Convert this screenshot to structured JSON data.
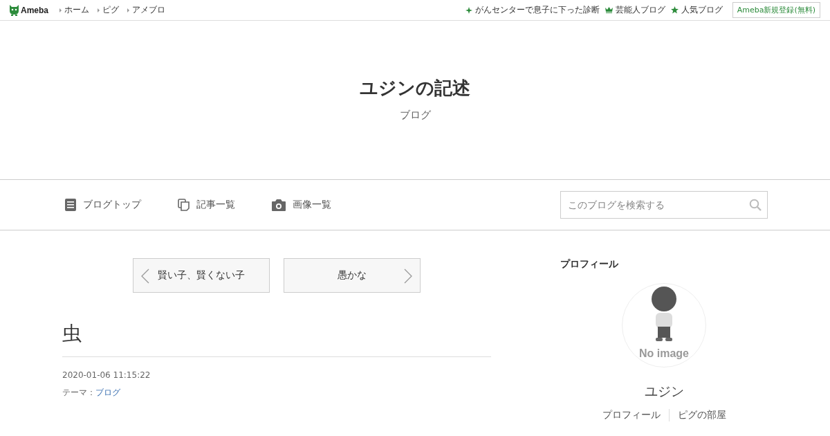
{
  "top_bar": {
    "logo": "Ameba",
    "nav_links": [
      "ホーム",
      "ピグ",
      "アメブロ"
    ],
    "promo_links": [
      {
        "kind": "sparkle",
        "label": "がんセンターで息子に下った診断"
      },
      {
        "kind": "crown",
        "label": "芸能人ブログ"
      },
      {
        "kind": "star",
        "label": "人気ブログ"
      }
    ],
    "signup_button": "Ameba新規登録(無料)"
  },
  "blog_header": {
    "title": "ユジンの記述",
    "subtitle": "ブログ"
  },
  "blog_nav": {
    "items": [
      {
        "kind": "document",
        "label": "ブログトップ"
      },
      {
        "kind": "pages",
        "label": "記事一覧"
      },
      {
        "kind": "camera",
        "label": "画像一覧"
      }
    ],
    "search": {
      "placeholder": "このブログを検索する"
    }
  },
  "pager": {
    "previous": "賢い子、賢くない子",
    "next": "愚かな"
  },
  "entry": {
    "title": "虫",
    "date": "2020-01-06 11:15:22",
    "theme_label": "テーマ：",
    "theme": "ブログ"
  },
  "profile": {
    "heading": "プロフィール",
    "avatar_caption": "No image",
    "name": "ユジン",
    "links": [
      "プロフィール",
      "ピグの部屋"
    ]
  }
}
